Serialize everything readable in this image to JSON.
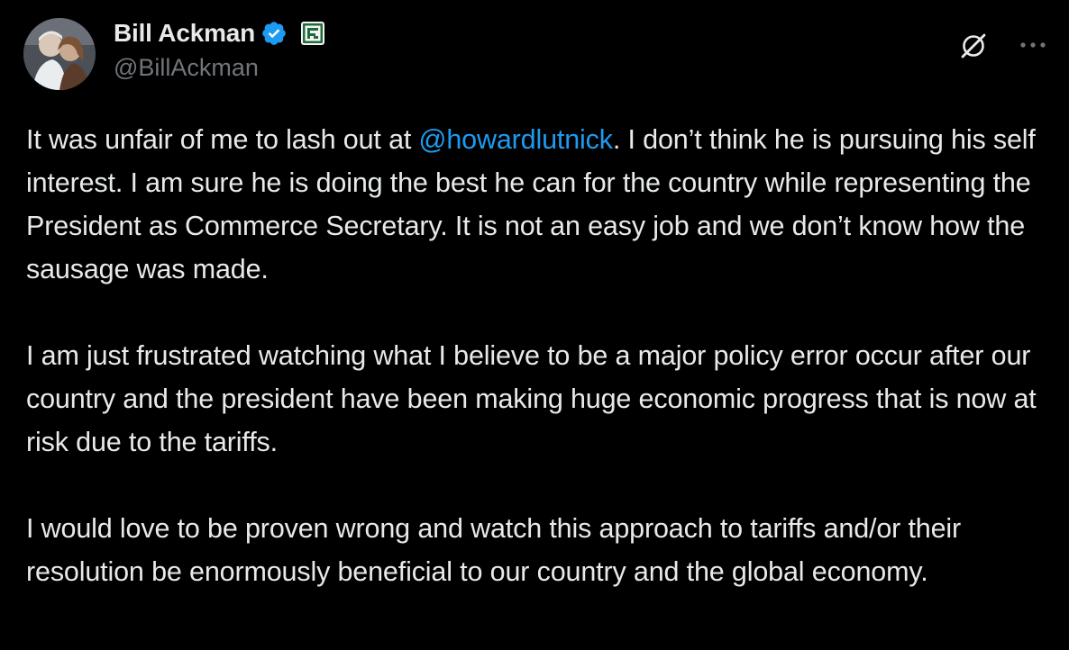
{
  "author": {
    "display_name": "Bill Ackman",
    "handle": "@BillAckman",
    "verified": true,
    "verified_color": "#1d9bf0",
    "affiliate_badge_color": "#2e7d32"
  },
  "actions": {
    "grok_icon": "grok-icon",
    "more_icon": "more-horizontal-icon"
  },
  "tweet": {
    "p1": {
      "before": "It was unfair of me to lash out at ",
      "mention": "@howardlutnick",
      "after": ". I don’t think he is pursuing his self interest. I am sure he is doing the best he can for the country while representing the President as Commerce Secretary. It is not an easy job and we don’t know how the sausage was made."
    },
    "p2": "I am just frustrated watching what I believe to be a major policy error occur after our country and the president have been making huge economic progress that is now at risk due to the tariffs.",
    "p3": "I would love to be proven wrong and watch this approach to tariffs and/or their resolution be enormously beneficial to our country and the global economy."
  },
  "colors": {
    "background": "#000000",
    "text": "#e7e9ea",
    "secondary": "#71767b",
    "link": "#1d9bf0"
  }
}
